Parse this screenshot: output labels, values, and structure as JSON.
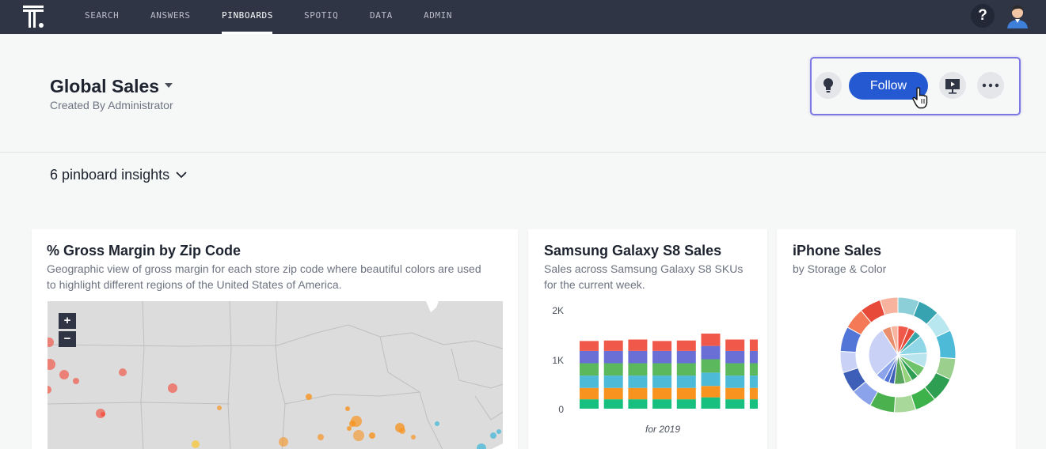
{
  "nav": {
    "items": [
      "SEARCH",
      "ANSWERS",
      "PINBOARDS",
      "SPOTIQ",
      "DATA",
      "ADMIN"
    ],
    "active": "PINBOARDS",
    "help_label": "?"
  },
  "pinboard": {
    "title": "Global Sales",
    "subtitle": "Created By Administrator",
    "follow_label": "Follow",
    "insights_label": "6 pinboard insights"
  },
  "icons": {
    "logo": "thoughtspot-logo",
    "help": "help-icon",
    "avatar": "user-avatar",
    "title_caret": "caret-down-icon",
    "insights_caret": "chevron-down-icon",
    "lightbulb": "lightbulb-icon",
    "present": "presentation-icon",
    "more": "more-dots-icon",
    "cursor": "hand-cursor-icon"
  },
  "colors": {
    "nav_bg": "#2f3545",
    "accent_blue": "#2459d1",
    "highlight_border": "#7c77e3"
  },
  "cards": {
    "map": {
      "title": "% Gross Margin by Zip Code",
      "desc_line1": "Geographic view of gross margin for each store zip code where beautiful colors are used",
      "desc_line2": "to highlight different regions of the United States of America.",
      "zoom_in": "+",
      "zoom_out": "−"
    },
    "samsung": {
      "title": "Samsung Galaxy S8 Sales",
      "desc_line1": "Sales across Samsung Galaxy S8 SKUs",
      "desc_line2": "for the current week.",
      "caption": "for 2019"
    },
    "iphone": {
      "title": "iPhone Sales",
      "desc": "by Storage & Color"
    }
  },
  "chart_data": [
    {
      "type": "bar",
      "stacked": true,
      "y_ticks": [
        "2K",
        "1K",
        "0"
      ],
      "ylim": [
        0,
        2000
      ],
      "categories": [
        "",
        "",
        "",
        "",
        "",
        "",
        "",
        ""
      ],
      "series_colors": [
        "#17c07f",
        "#f7931e",
        "#4dbad8",
        "#5cb85c",
        "#6a6fd6",
        "#f0594a"
      ],
      "series": [
        {
          "values": [
            190,
            190,
            190,
            190,
            190,
            230,
            190,
            190
          ]
        },
        {
          "values": [
            230,
            230,
            230,
            230,
            230,
            230,
            230,
            230
          ]
        },
        {
          "values": [
            250,
            250,
            250,
            250,
            250,
            270,
            250,
            250
          ]
        },
        {
          "values": [
            250,
            250,
            250,
            250,
            250,
            270,
            250,
            250
          ]
        },
        {
          "values": [
            250,
            250,
            250,
            250,
            250,
            270,
            250,
            250
          ]
        },
        {
          "values": [
            200,
            210,
            230,
            200,
            210,
            250,
            230,
            230
          ]
        }
      ],
      "caption": "for 2019"
    },
    {
      "type": "pie",
      "variant": "sunburst",
      "inner_colors": [
        "#f0594a",
        "#e84a3a",
        "#37a6a8",
        "#8fd6e6",
        "#b9e4ee",
        "#6ec36b",
        "#2e9e52",
        "#95d17a",
        "#5ba55c",
        "#3e5fb8",
        "#5275d8",
        "#8aa3ea",
        "#c9d2f6",
        "#e98f6d",
        "#f7b39d"
      ],
      "inner_values": [
        6,
        4,
        4,
        10,
        8,
        6,
        4,
        4,
        6,
        3,
        3,
        5,
        28,
        5,
        4
      ],
      "outer_colors": [
        "#8ccfd8",
        "#38a3b0",
        "#b9e7ef",
        "#4dbad8",
        "#9bcf8d",
        "#2e9e52",
        "#3eb24a",
        "#a9d99a",
        "#4bb14f",
        "#8aa3ea",
        "#3e5fb8",
        "#c9d2f6",
        "#5275d8",
        "#f47a57",
        "#e84a3a",
        "#f7b39d"
      ],
      "outer_values": [
        6,
        6,
        6,
        8,
        6,
        7,
        6,
        6,
        7,
        6,
        6,
        6,
        7,
        6,
        6,
        5
      ]
    }
  ]
}
